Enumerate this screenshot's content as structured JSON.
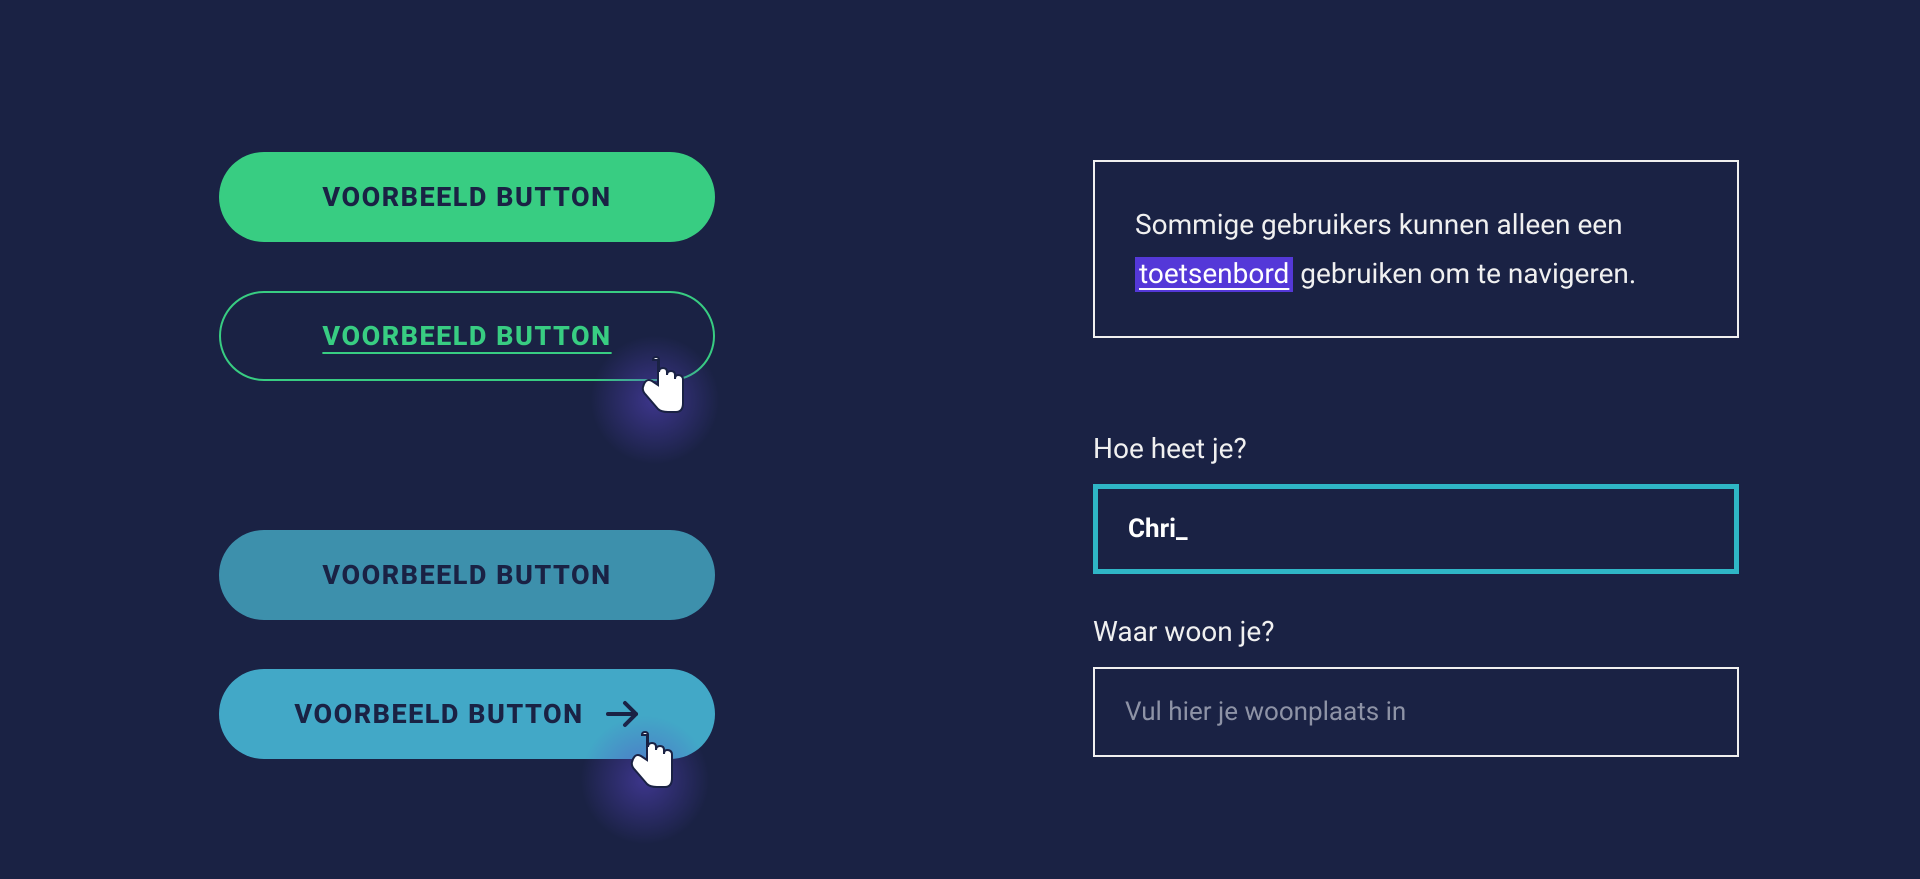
{
  "buttons": {
    "b1": "VOORBEELD BUTTON",
    "b2": "VOORBEELD BUTTON",
    "b3": "VOORBEELD BUTTON",
    "b4": "VOORBEELD BUTTON"
  },
  "info": {
    "before_link": "Sommige gebruikers kunnen alleen een ",
    "link": "toetsenbord",
    "after_link": " gebruiken om te navigeren."
  },
  "form": {
    "name_label": "Hoe heet je?",
    "name_value": "Chri",
    "city_label": "Waar woon je?",
    "city_placeholder": "Vul hier je woonplaats in"
  },
  "colors": {
    "bg": "#1a2244",
    "green": "#38cd82",
    "teal": "#42a8c7",
    "teal_muted": "#3d90ac",
    "focus_ring": "#2fb6c6",
    "link_bg": "#5438d8"
  }
}
